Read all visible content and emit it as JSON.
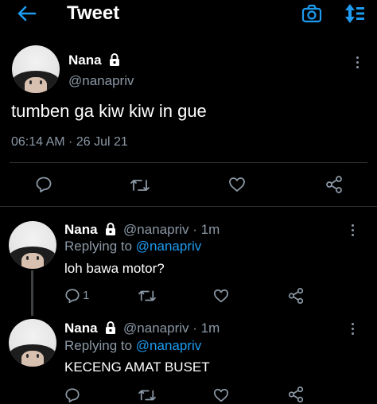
{
  "header": {
    "title": "Tweet"
  },
  "main_tweet": {
    "display_name": "Nana",
    "handle": "@nanapriv",
    "text": "tumben ga kiw kiw in gue",
    "timestamp": "06:14 AM · 26 Jul 21"
  },
  "replies": [
    {
      "display_name": "Nana",
      "handle_time": "@nanapriv · 1m",
      "replying_prefix": "Replying to",
      "replying_handle": "@nanapriv",
      "text": "loh bawa motor?",
      "reply_count": "1"
    },
    {
      "display_name": "Nana",
      "handle_time": "@nanapriv · 1m",
      "replying_prefix": "Replying to",
      "replying_handle": "@nanapriv",
      "text": "KECENG AMAT BUSET",
      "reply_count": ""
    }
  ],
  "colors": {
    "accent": "#1d9bf0",
    "muted": "#8b98a5",
    "background": "#000000",
    "divider": "#2f3336"
  }
}
